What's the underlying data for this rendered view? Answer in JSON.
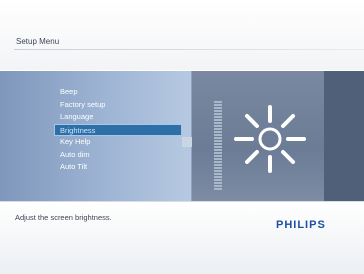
{
  "header": {
    "title": "Setup Menu"
  },
  "menu": {
    "items": [
      {
        "label": "Beep"
      },
      {
        "label": "Factory setup"
      },
      {
        "label": "Language"
      },
      {
        "label": "Brightness"
      },
      {
        "label": "Key Help"
      },
      {
        "label": "Auto dim"
      },
      {
        "label": "Auto Tilt"
      }
    ],
    "selected": "Brightness"
  },
  "preview": {
    "icon": "sun-brightness-icon",
    "level_indicator": "brightness-level-bar"
  },
  "footer": {
    "status_text": "Adjust the screen brightness.",
    "brand": "PHILIPS"
  },
  "colors": {
    "accent": "#2f6fa8",
    "brand": "#1e4fa1",
    "panel": "#8ea4c4"
  }
}
